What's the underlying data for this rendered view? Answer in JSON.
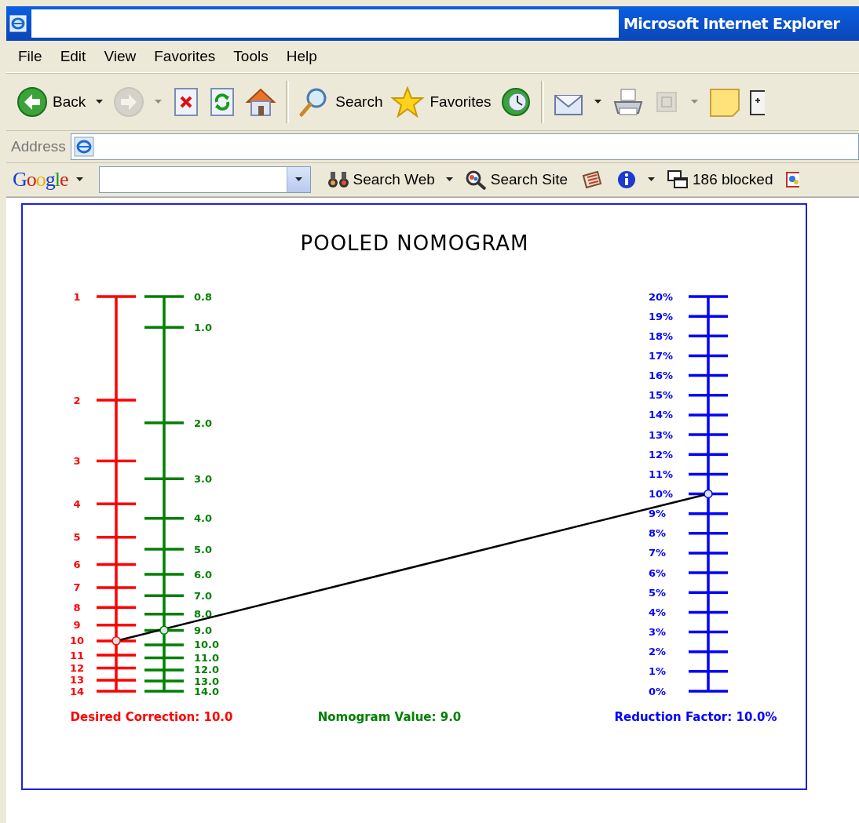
{
  "window": {
    "title": "Microsoft Internet Explorer"
  },
  "menu": [
    {
      "label": "File"
    },
    {
      "label": "Edit"
    },
    {
      "label": "View"
    },
    {
      "label": "Favorites"
    },
    {
      "label": "Tools"
    },
    {
      "label": "Help"
    }
  ],
  "toolbar": [
    {
      "kind": "back",
      "label": "Back",
      "disabled": false,
      "dropdown": true
    },
    {
      "kind": "forward",
      "disabled": true,
      "dropdown": true
    },
    {
      "kind": "stop",
      "disabled": false,
      "dropdown": false
    },
    {
      "kind": "refresh",
      "disabled": false,
      "dropdown": false
    },
    {
      "kind": "home",
      "disabled": false,
      "dropdown": false
    },
    {
      "kind": "separator"
    },
    {
      "kind": "search",
      "label": "Search",
      "disabled": false,
      "dropdown": false
    },
    {
      "kind": "favorites",
      "label": "Favorites",
      "disabled": false,
      "dropdown": false
    },
    {
      "kind": "history",
      "disabled": false,
      "dropdown": false
    },
    {
      "kind": "separator"
    },
    {
      "kind": "mail",
      "disabled": false,
      "dropdown": true
    },
    {
      "kind": "print",
      "disabled": false,
      "dropdown": false
    },
    {
      "kind": "edit",
      "disabled": true,
      "dropdown": true
    },
    {
      "kind": "note",
      "disabled": false,
      "dropdown": false
    },
    {
      "kind": "window",
      "disabled": false,
      "dropdown": false
    }
  ],
  "address_bar": {
    "label": "Address"
  },
  "google_bar": {
    "logo": "Google",
    "items": [
      {
        "kind": "search-web",
        "label": "Search Web",
        "dropdown": true
      },
      {
        "kind": "search-site",
        "label": "Search Site",
        "dropdown": false
      },
      {
        "kind": "news",
        "dropdown": false
      },
      {
        "kind": "info",
        "dropdown": true
      },
      {
        "kind": "blocker",
        "label": "186 blocked",
        "dropdown": false
      },
      {
        "kind": "options",
        "dropdown": false
      }
    ]
  },
  "nomogram": {
    "title": "POOLED NOMOGRAM",
    "scales": [
      {
        "kind": "log",
        "color": "#ff0000",
        "caption": "Desired Correction: 10.0",
        "ticks": [
          {
            "label": "1",
            "selected": false
          },
          {
            "label": "2",
            "selected": false
          },
          {
            "label": "3",
            "selected": false
          },
          {
            "label": "4",
            "selected": false
          },
          {
            "label": "5",
            "selected": false
          },
          {
            "label": "6",
            "selected": false
          },
          {
            "label": "7",
            "selected": false
          },
          {
            "label": "8",
            "selected": false
          },
          {
            "label": "9",
            "selected": false
          },
          {
            "label": "10",
            "selected": true
          },
          {
            "label": "11",
            "selected": false
          },
          {
            "label": "12",
            "selected": false
          },
          {
            "label": "13",
            "selected": false
          },
          {
            "label": "14",
            "selected": false
          }
        ]
      },
      {
        "kind": "log",
        "color": "#008000",
        "caption": "Nomogram Value: 9.0",
        "ticks": [
          {
            "label": "0.8",
            "selected": false
          },
          {
            "label": "1.0",
            "selected": false
          },
          {
            "label": "2.0",
            "selected": false
          },
          {
            "label": "3.0",
            "selected": false
          },
          {
            "label": "4.0",
            "selected": false
          },
          {
            "label": "5.0",
            "selected": false
          },
          {
            "label": "6.0",
            "selected": false
          },
          {
            "label": "7.0",
            "selected": false
          },
          {
            "label": "8.0",
            "selected": false
          },
          {
            "label": "9.0",
            "selected": true
          },
          {
            "label": "10.0",
            "selected": false
          },
          {
            "label": "11.0",
            "selected": false
          },
          {
            "label": "12.0",
            "selected": false
          },
          {
            "label": "13.0",
            "selected": false
          },
          {
            "label": "14.0",
            "selected": false
          }
        ]
      },
      {
        "kind": "linear",
        "color": "#0000ff",
        "caption": "Reduction Factor: 10.0%",
        "ticks": [
          {
            "label": "20%",
            "selected": false
          },
          {
            "label": "19%",
            "selected": false
          },
          {
            "label": "18%",
            "selected": false
          },
          {
            "label": "17%",
            "selected": false
          },
          {
            "label": "16%",
            "selected": false
          },
          {
            "label": "15%",
            "selected": false
          },
          {
            "label": "14%",
            "selected": false
          },
          {
            "label": "13%",
            "selected": false
          },
          {
            "label": "12%",
            "selected": false
          },
          {
            "label": "11%",
            "selected": false
          },
          {
            "label": "10%",
            "selected": true
          },
          {
            "label": "9%",
            "selected": false
          },
          {
            "label": "8%",
            "selected": false
          },
          {
            "label": "7%",
            "selected": false
          },
          {
            "label": "6%",
            "selected": false
          },
          {
            "label": "5%",
            "selected": false
          },
          {
            "label": "4%",
            "selected": false
          },
          {
            "label": "3%",
            "selected": false
          },
          {
            "label": "2%",
            "selected": false
          },
          {
            "label": "1%",
            "selected": false
          },
          {
            "label": "0%",
            "selected": false
          }
        ]
      }
    ]
  }
}
